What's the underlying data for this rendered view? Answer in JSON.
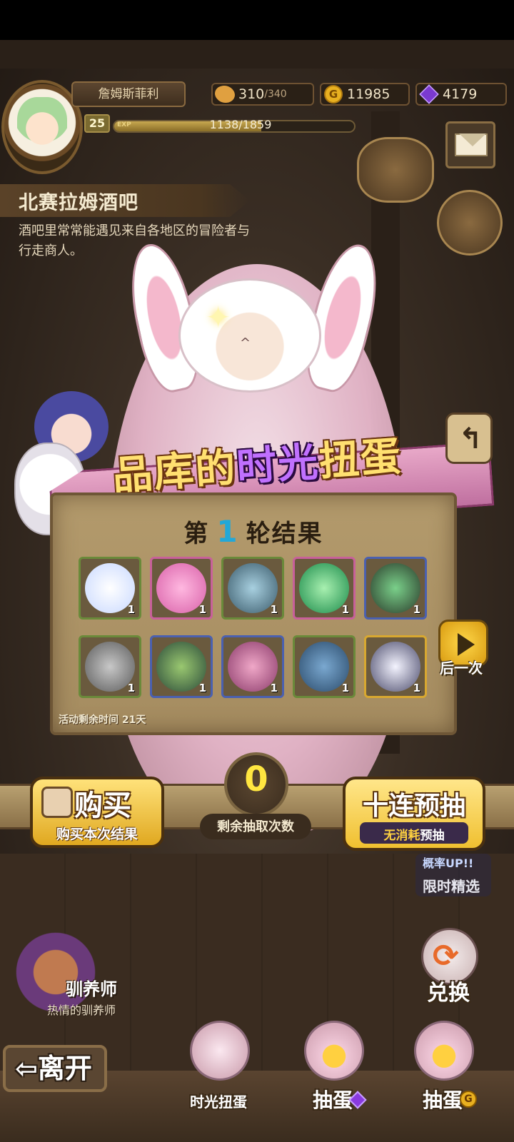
{
  "player": {
    "name": "詹姆斯菲利",
    "level": "25",
    "exp_label": "EXP",
    "exp_text": "1138/1859",
    "exp_fraction": 0.612
  },
  "resources": {
    "stamina": "310",
    "stamina_max": "/340",
    "gold": "11985",
    "gold_symbol": "G",
    "gems": "4179"
  },
  "location": {
    "title": "北赛拉姆酒吧",
    "description": "酒吧里常常能遇见来自各地区的冒险者与行走商人。"
  },
  "gacha": {
    "title_part1": "品库的",
    "title_highlight": "时光",
    "title_part2": "扭蛋",
    "round_prefix": "第",
    "round_number": "1",
    "round_suffix": "轮结果",
    "timer": "活动剩余时间 21天",
    "next_label": "后一次",
    "remaining_draws": "0",
    "remaining_label": "剩余抽取次数"
  },
  "items": [
    {
      "name": "cloud-planet",
      "count": "1",
      "rarity": "green"
    },
    {
      "name": "pink-splash",
      "count": "1",
      "rarity": "pink"
    },
    {
      "name": "spiral-shell",
      "count": "1",
      "rarity": "green"
    },
    {
      "name": "green-orb",
      "count": "1",
      "rarity": "pink"
    },
    {
      "name": "green-armor",
      "count": "1",
      "rarity": "blue"
    },
    {
      "name": "stone-shield",
      "count": "1",
      "rarity": "green"
    },
    {
      "name": "leaf-helmet",
      "count": "1",
      "rarity": "blue"
    },
    {
      "name": "mushroom-cap",
      "count": "1",
      "rarity": "blue"
    },
    {
      "name": "sprout-fish",
      "count": "1",
      "rarity": "green"
    },
    {
      "name": "crystal-armor",
      "count": "1",
      "rarity": "gold"
    }
  ],
  "rarity_colors": {
    "green": "#6a8a3a",
    "pink": "#c8609a",
    "blue": "#4a60b0",
    "gold": "#d8a830"
  },
  "actions": {
    "buy_title": "购买",
    "buy_sub": "购买本次结果",
    "ten_title": "十连预抽",
    "ten_sub_hi": "无消耗",
    "ten_sub": "预抽"
  },
  "side": {
    "limited_up": "概率UP!!",
    "limited_select": "限时精选",
    "exchange": "兑换"
  },
  "npc": {
    "name": "驯养师",
    "title": "热情的驯养师"
  },
  "nav": {
    "leave": "⇦离开",
    "time_gacha": "时光扭蛋",
    "draw_gem": "抽蛋",
    "draw_gold": "抽蛋",
    "gold_symbol": "G"
  }
}
